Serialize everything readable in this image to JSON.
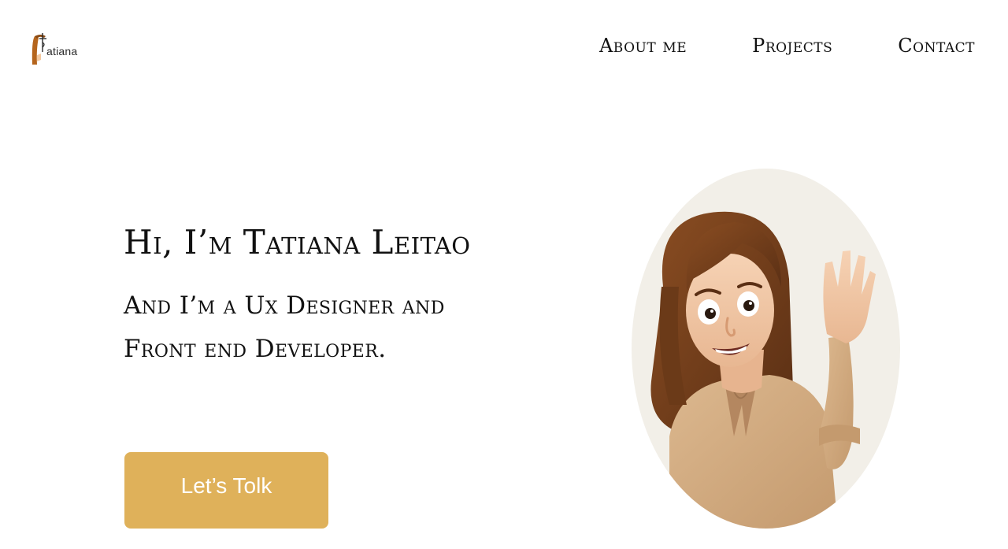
{
  "header": {
    "logo_text": "atiana",
    "nav": [
      {
        "label": "About me"
      },
      {
        "label": "Projects"
      },
      {
        "label": "Contact"
      }
    ]
  },
  "hero": {
    "title": "Hi, I’m Tatiana Leitao",
    "subtitle_line1": "And I’m a Ux Designer and",
    "subtitle_line2": "Front end Developer.",
    "cta_label": "Let’s Tolk"
  },
  "colors": {
    "accent": "#dfb15a",
    "avatar_background": "#f2efe8",
    "logo_brown": "#b5651d"
  },
  "icons": {
    "logo": "letter-t-hair-logo",
    "avatar": "memoji-waving-woman"
  }
}
